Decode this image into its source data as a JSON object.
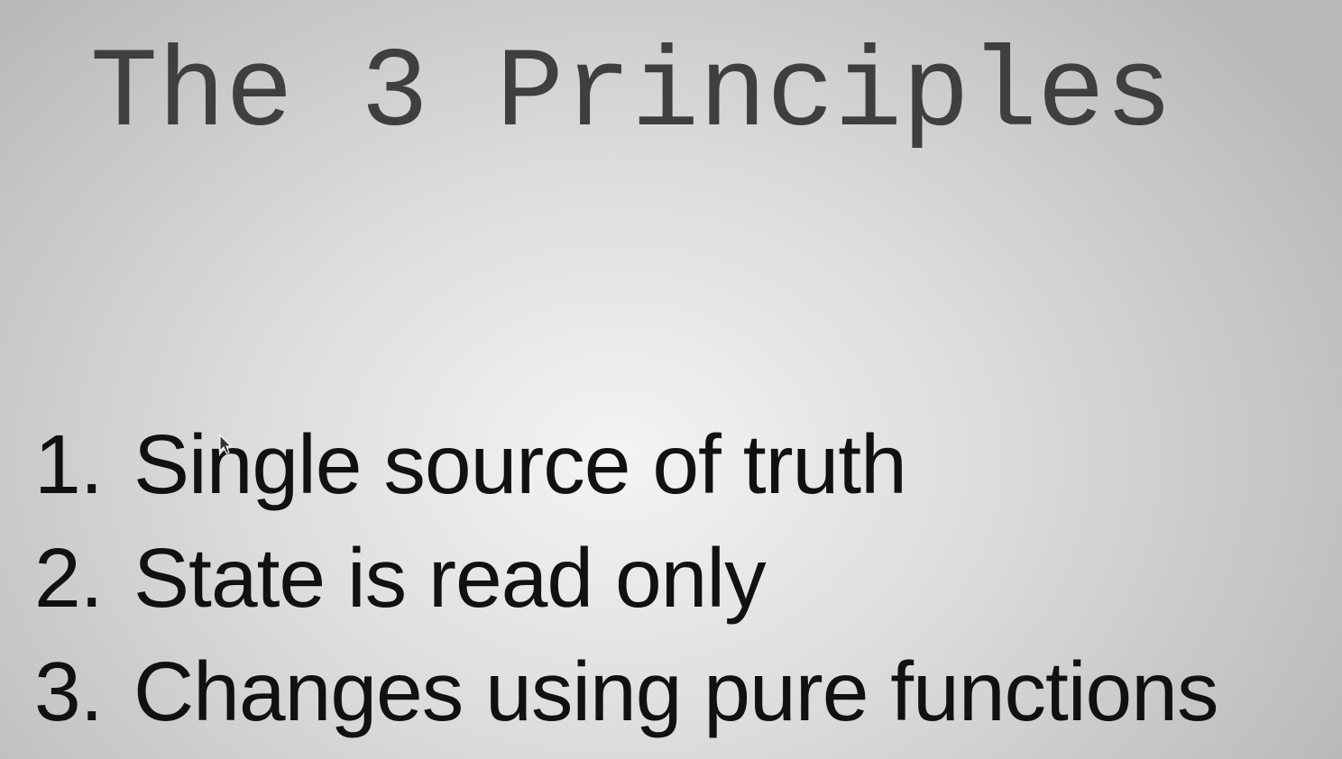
{
  "slide": {
    "title": "The 3 Principles",
    "principles": [
      {
        "number": "1.",
        "text": "Single source of truth"
      },
      {
        "number": "2.",
        "text": "State is read only"
      },
      {
        "number": "3.",
        "text": "Changes using pure functions"
      }
    ]
  },
  "icons": {
    "cursor": "mouse-pointer-icon"
  },
  "colors": {
    "title": "#3f3f3f",
    "body_text": "#111111",
    "background_center": "#f4f4f4",
    "background_edge": "#b9b9b9"
  }
}
